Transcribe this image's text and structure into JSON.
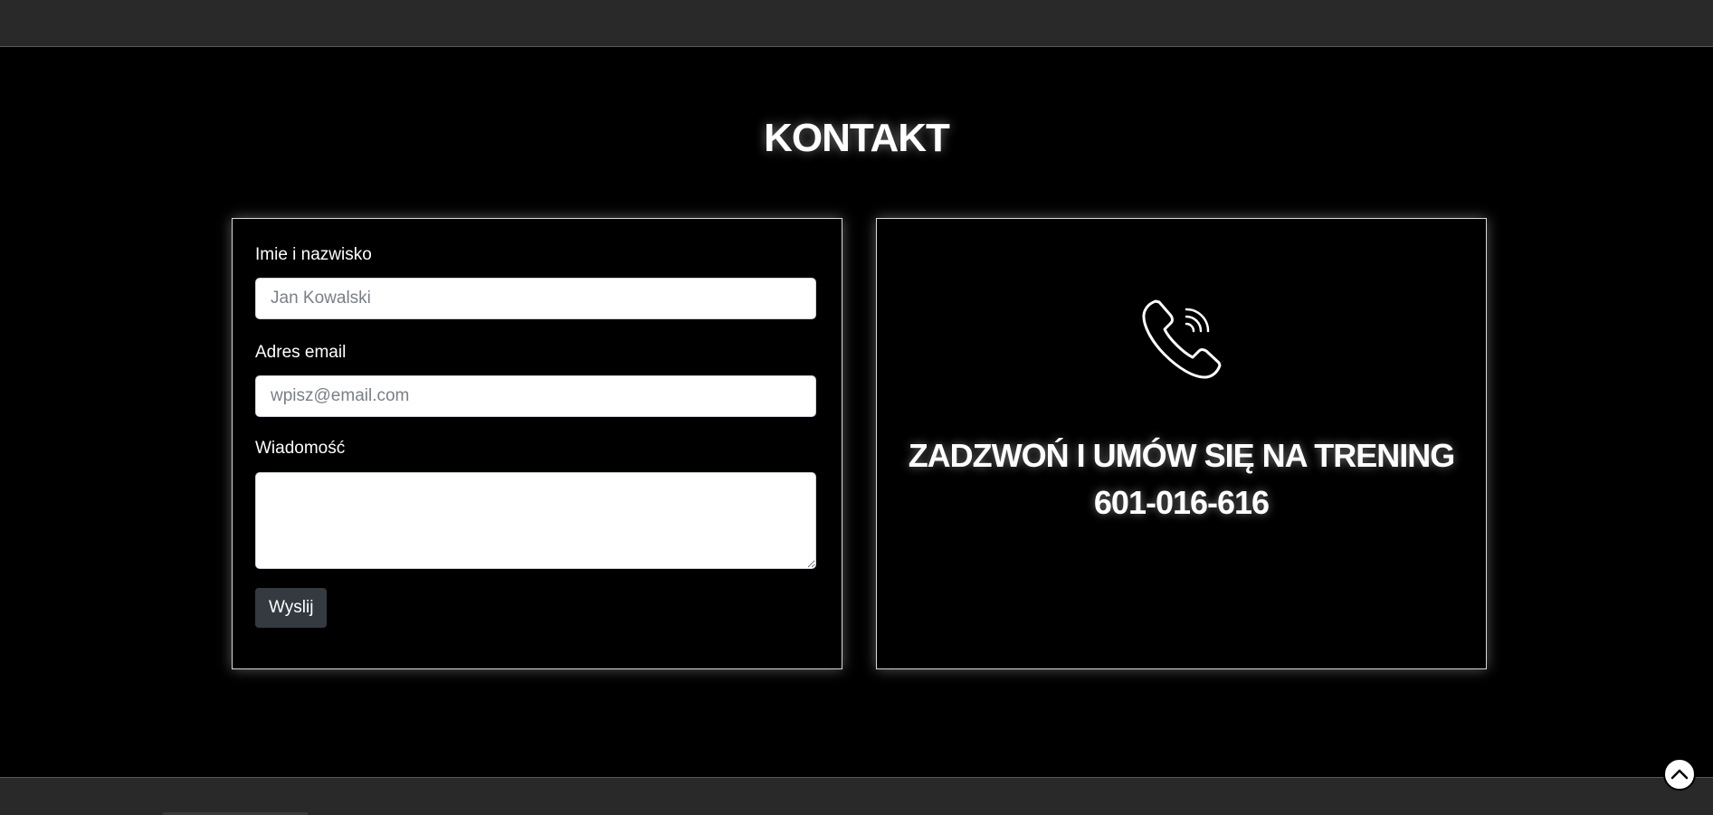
{
  "section": {
    "title": "KONTAKT"
  },
  "form": {
    "name_label": "Imie i nazwisko",
    "name_placeholder": "Jan Kowalski",
    "email_label": "Adres email",
    "email_placeholder": "wpisz@email.com",
    "message_label": "Wiadomość",
    "message_value": "",
    "submit_label": "Wyslij"
  },
  "call": {
    "icon": "phone-ringing-icon",
    "line1": "ZADZWOŃ I UMÓW SIĘ NA TRENING",
    "phone": "601-016-616"
  },
  "scroll_top": {
    "icon": "chevron-up-icon"
  },
  "colors": {
    "page_background": "#000000",
    "bar_background": "#292929",
    "button_background": "#343a40",
    "text": "#ffffff"
  }
}
